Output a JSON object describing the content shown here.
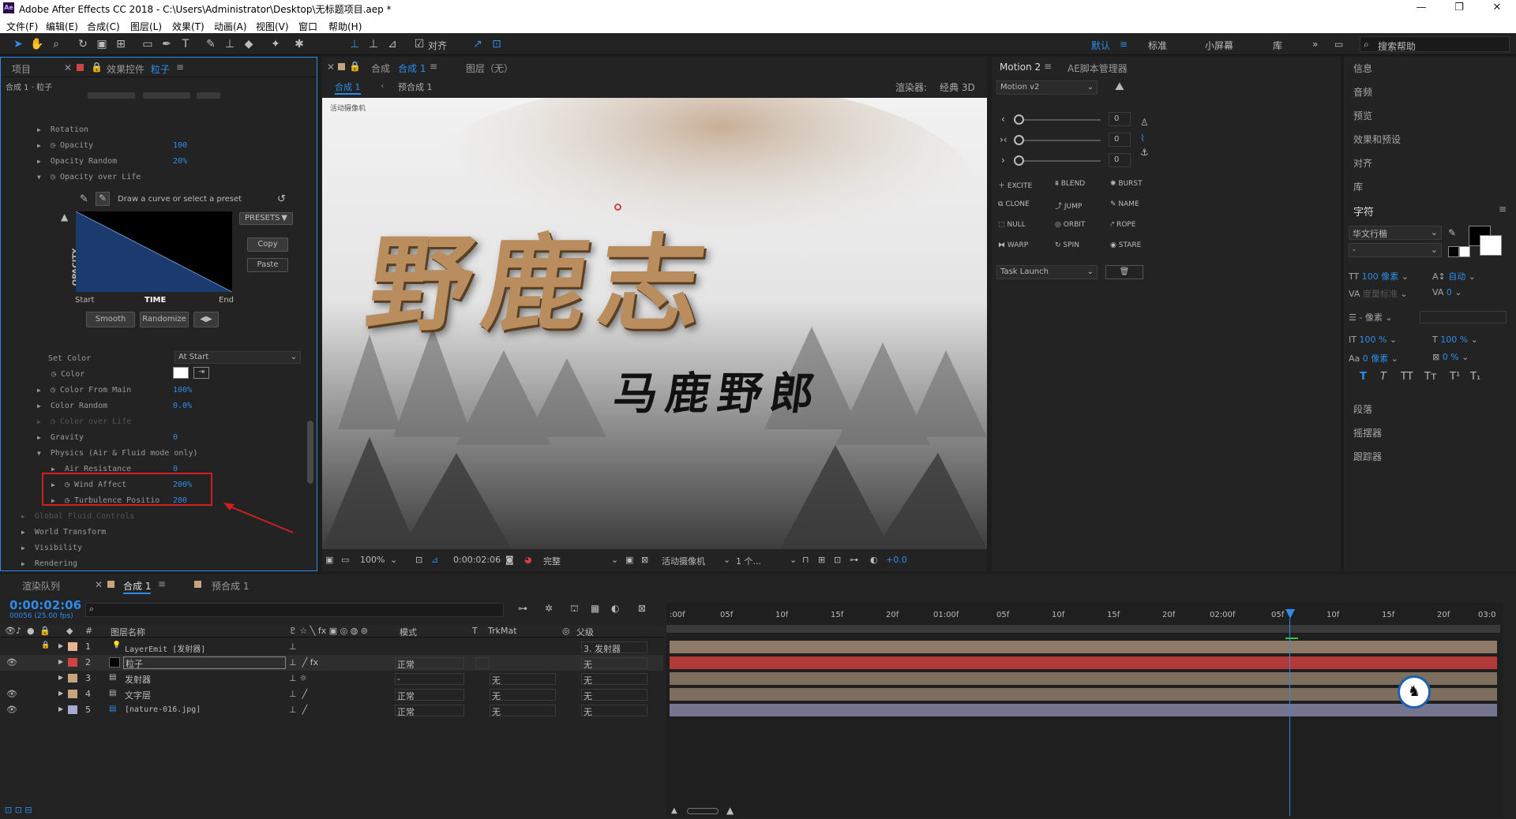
{
  "window": {
    "title": "Adobe After Effects CC 2018 - C:\\Users\\Administrator\\Desktop\\无标题项目.aep *",
    "logo": "Ae",
    "controls": [
      "—",
      "❐",
      "✕"
    ]
  },
  "menu": [
    "文件(F)",
    "编辑(E)",
    "合成(C)",
    "图层(L)",
    "效果(T)",
    "动画(A)",
    "视图(V)",
    "窗口",
    "帮助(H)"
  ],
  "toolbar": {
    "align_label": "对齐",
    "workspaces": [
      "默认",
      "标准",
      "小屏幕",
      "库"
    ],
    "search_placeholder": "搜索帮助"
  },
  "effect_panel": {
    "tab_project": "项目",
    "tab_effects": "效果控件",
    "layer_name": "粒子",
    "breadcrumb": "合成 1 · 粒子",
    "props": [
      {
        "name": "Rotation",
        "value": "",
        "indent": 2,
        "arrow": "▶",
        "sw": false
      },
      {
        "name": "Opacity",
        "value": "100",
        "indent": 2,
        "arrow": "▶",
        "sw": true
      },
      {
        "name": "Opacity Random",
        "value": "20%",
        "indent": 2,
        "arrow": "▶",
        "sw": false
      },
      {
        "name": "Opacity over Life",
        "value": "",
        "indent": 2,
        "arrow": "▼",
        "sw": true
      }
    ],
    "curve": {
      "hint": "Draw a curve or select a preset",
      "presets": "PRESETS",
      "copy": "Copy",
      "paste": "Paste",
      "ylabel": "OPACITY",
      "start": "Start",
      "time": "TIME",
      "end": "End",
      "smooth": "Smooth",
      "randomize": "Randomize"
    },
    "props2": [
      {
        "name": "Set Color",
        "value": "At Start"
      },
      {
        "name": "Color",
        "value": ""
      },
      {
        "name": "Color From Main",
        "value": "100%"
      },
      {
        "name": "Color Random",
        "value": "0.0%"
      },
      {
        "name": "Color over Life",
        "value": ""
      },
      {
        "name": "Gravity",
        "value": "0"
      },
      {
        "name": "Physics (Air & Fluid mode only)",
        "value": ""
      },
      {
        "name": "Air Resistance",
        "value": "0"
      },
      {
        "name": "Wind Affect",
        "value": "200%"
      },
      {
        "name": "Turbulence Positio",
        "value": "200"
      },
      {
        "name": "Global Fluid Controls",
        "value": ""
      },
      {
        "name": "World Transform",
        "value": ""
      },
      {
        "name": "Visibility",
        "value": ""
      },
      {
        "name": "Rendering",
        "value": ""
      }
    ]
  },
  "comp_panel": {
    "tab_comp": "合成",
    "comp_name": "合成 1",
    "tab_layer": "图层（无）",
    "crumb1": "合成 1",
    "crumb2": "预合成 1",
    "renderer_label": "渲染器:",
    "renderer": "经典 3D",
    "camera_label": "活动摄像机",
    "title_big": "野鹿志",
    "subtitle": "马鹿野郎",
    "footer": {
      "zoom": "100%",
      "time": "0:00:02:06",
      "quality": "完整",
      "camera": "活动摄像机",
      "views": "1 个...",
      "exposure": "+0.0"
    }
  },
  "motion_panel": {
    "tab1": "Motion 2",
    "tab2": "AE脚本管理器",
    "version": "Motion v2",
    "slider_values": [
      "0",
      "0",
      "0"
    ],
    "buttons": [
      "EXCITE",
      "BLEND",
      "BURST",
      "CLONE",
      "JUMP",
      "NAME",
      "NULL",
      "ORBIT",
      "ROPE",
      "WARP",
      "SPIN",
      "STARE"
    ],
    "task": "Task Launch"
  },
  "right_panel": {
    "items": [
      "信息",
      "音频",
      "预览",
      "效果和预设",
      "对齐",
      "库"
    ],
    "char_title": "字符",
    "font": "华文行楷",
    "font_style": "-",
    "font_size": "100 像素",
    "leading": "自动",
    "tracking_label": "度量标准",
    "tracking": "0",
    "stroke": "- 像素",
    "v_scale": "100 %",
    "h_scale": "100 %",
    "baseline": "0 像素",
    "tsume": "0 %",
    "items2": [
      "段落",
      "摇摆器",
      "跟踪器"
    ]
  },
  "timeline": {
    "tab_render": "渲染队列",
    "tab_comp": "合成 1",
    "tab_precomp": "预合成 1",
    "timecode": "0:00:02:06",
    "fps": "00056 (25.00 fps)",
    "headers": {
      "num": "#",
      "name": "图层名称",
      "mode": "模式",
      "t": "T",
      "trkmat": "TrkMat",
      "parent": "父级"
    },
    "ruler": [
      ":00f",
      "05f",
      "10f",
      "15f",
      "20f",
      "01:00f",
      "05f",
      "10f",
      "15f",
      "20f",
      "02:00f",
      "05f",
      "10f",
      "15f",
      "20f",
      "03:0"
    ],
    "layers": [
      {
        "num": "1",
        "name": "LayerEmit [发射器]",
        "mode": "",
        "trk": "",
        "parent": "3. 发射器",
        "color": "#e8b58e"
      },
      {
        "num": "2",
        "name": "粒子",
        "mode": "正常",
        "trk": "",
        "parent": "无",
        "color": "#d04343"
      },
      {
        "num": "3",
        "name": "发射器",
        "mode": "-",
        "trk": "无",
        "parent": "无",
        "color": "#c6a57d"
      },
      {
        "num": "4",
        "name": "文字层",
        "mode": "正常",
        "trk": "无",
        "parent": "无",
        "color": "#c6a57d"
      },
      {
        "num": "5",
        "name": "[nature-016.jpg]",
        "mode": "正常",
        "trk": "无",
        "parent": "无",
        "color": "#a9a9d4"
      }
    ]
  }
}
